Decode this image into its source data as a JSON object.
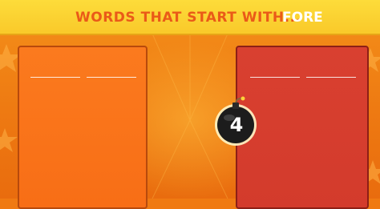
{
  "header": {
    "title_prefix": "WORDS THAT START WITH...",
    "title_word": "FORE"
  },
  "timer": {
    "value": "4"
  },
  "colors": {
    "header_yellow": "#fddc3a",
    "title_orange": "#ea5a18",
    "background_orange": "#f07a12",
    "left_panel": "#fb7a1e",
    "right_panel": "#d94030",
    "bomb": "#1c1c1c"
  },
  "icons": {
    "star": "star-icon",
    "bomb": "bomb-icon"
  }
}
